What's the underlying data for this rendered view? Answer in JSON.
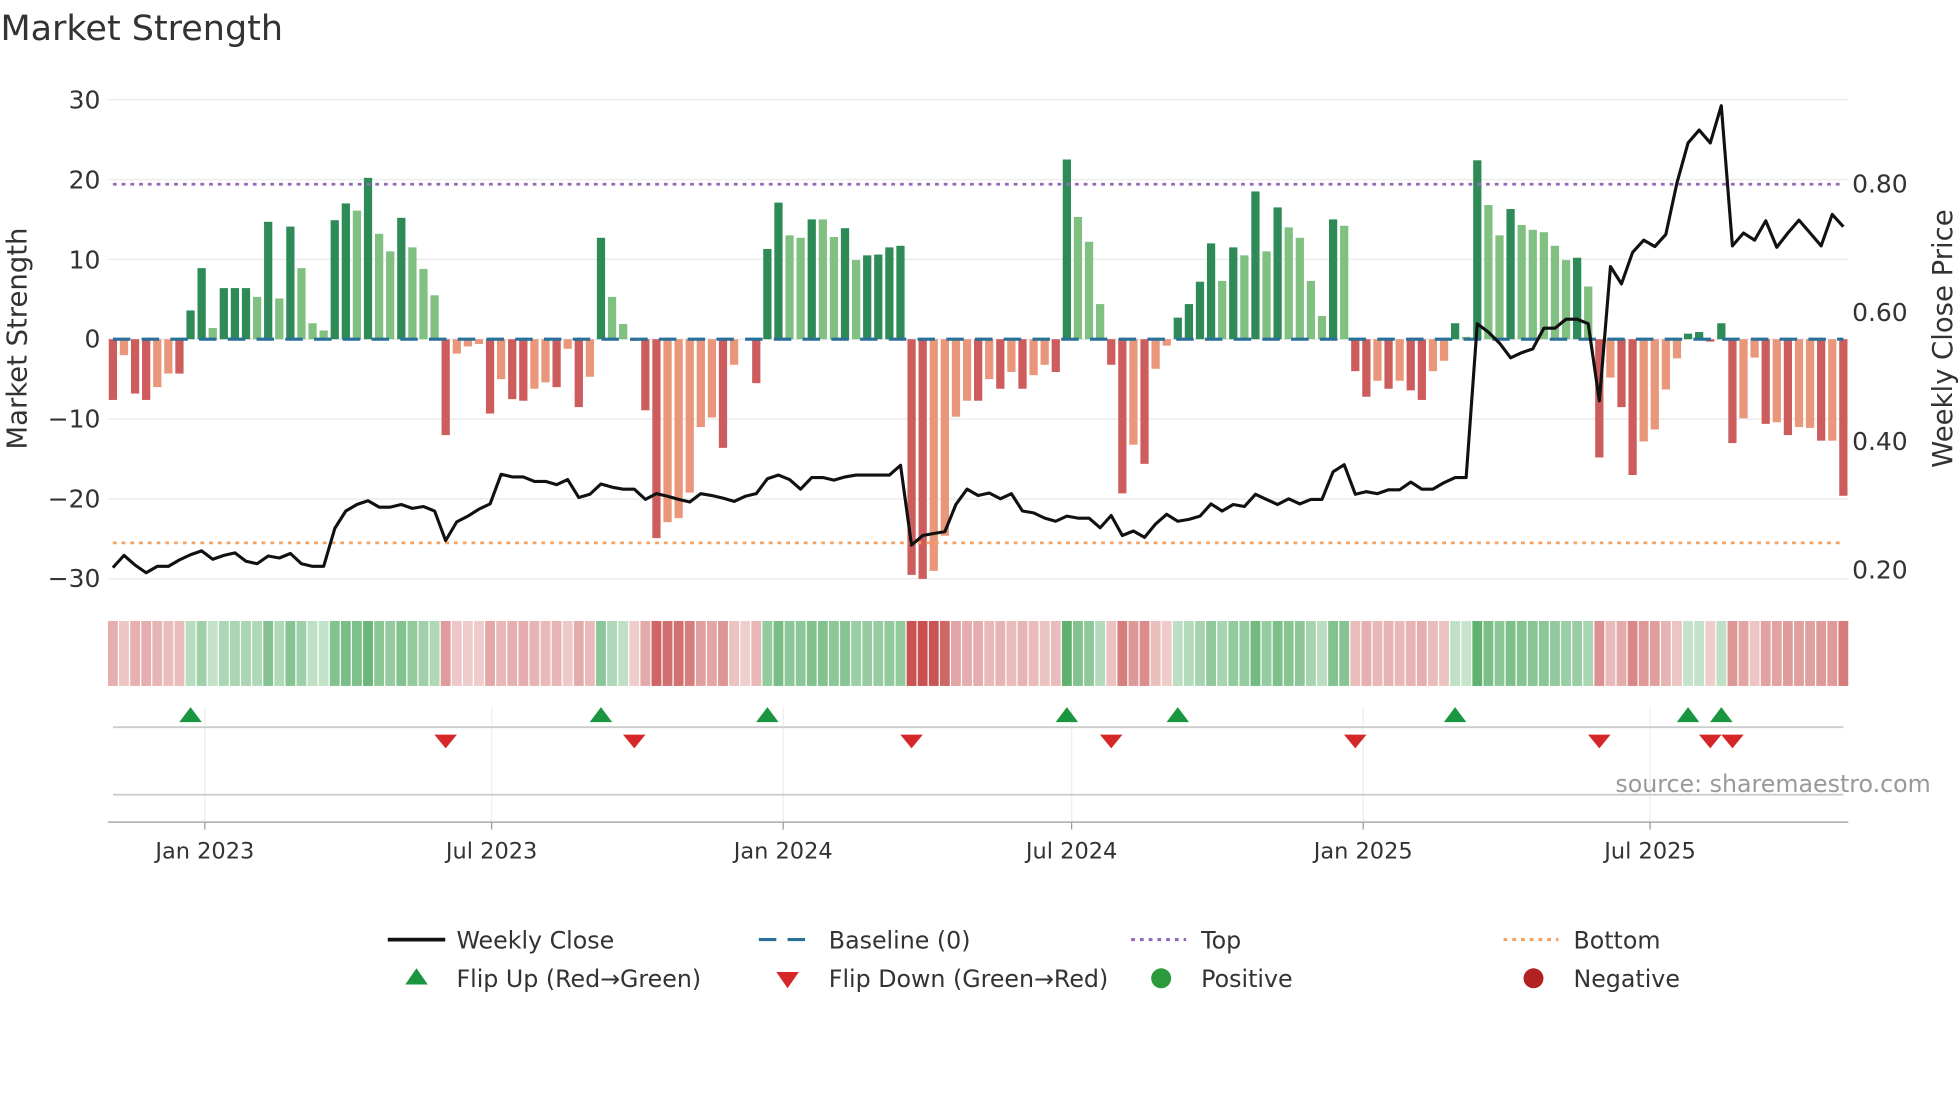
{
  "chart_data": {
    "type": "bar",
    "title": "Market Strength",
    "ylabel": "Market Strength",
    "ylabel_right": "Weekly Close Price",
    "ylim": [
      -32.3,
      32.3
    ],
    "ylim_right": [
      0.157,
      0.959
    ],
    "yticks": [
      "30",
      "20",
      "10",
      "0",
      "−10",
      "−20",
      "−30"
    ],
    "yticks_right": [
      "0.80",
      "0.60",
      "0.40",
      "0.20"
    ],
    "xticks": [
      "Jan 2023",
      "Jul 2023",
      "Jan 2024",
      "Jul 2024",
      "Jan 2025",
      "Jul 2025"
    ],
    "grid": true,
    "legend_placement": "bottom",
    "source": "source: sharemaestro.com",
    "top_level": 19.4,
    "bottom_level": -25.5,
    "dates": [
      "2022-11-04",
      "2022-11-11",
      "2022-11-18",
      "2022-11-25",
      "2022-12-02",
      "2022-12-09",
      "2022-12-16",
      "2022-12-23",
      "2022-12-30",
      "2023-01-06",
      "2023-01-13",
      "2023-01-20",
      "2023-01-27",
      "2023-02-03",
      "2023-02-10",
      "2023-02-17",
      "2023-02-24",
      "2023-03-03",
      "2023-03-10",
      "2023-03-17",
      "2023-03-24",
      "2023-03-31",
      "2023-04-07",
      "2023-04-14",
      "2023-04-21",
      "2023-04-28",
      "2023-05-05",
      "2023-05-12",
      "2023-05-19",
      "2023-05-26",
      "2023-06-02",
      "2023-06-09",
      "2023-06-16",
      "2023-06-23",
      "2023-06-30",
      "2023-07-07",
      "2023-07-14",
      "2023-07-21",
      "2023-07-28",
      "2023-08-04",
      "2023-08-11",
      "2023-08-18",
      "2023-08-25",
      "2023-09-01",
      "2023-09-08",
      "2023-09-15",
      "2023-09-22",
      "2023-09-29",
      "2023-10-06",
      "2023-10-13",
      "2023-10-20",
      "2023-10-27",
      "2023-11-03",
      "2023-11-10",
      "2023-11-17",
      "2023-11-24",
      "2023-12-01",
      "2023-12-08",
      "2023-12-15",
      "2023-12-22",
      "2023-12-29",
      "2024-01-05",
      "2024-01-12",
      "2024-01-19",
      "2024-01-26",
      "2024-02-02",
      "2024-02-09",
      "2024-02-16",
      "2024-02-23",
      "2024-03-01",
      "2024-03-08",
      "2024-03-15",
      "2024-03-22",
      "2024-03-29",
      "2024-04-05",
      "2024-04-12",
      "2024-04-19",
      "2024-04-26",
      "2024-05-03",
      "2024-05-10",
      "2024-05-17",
      "2024-05-24",
      "2024-05-31",
      "2024-06-07",
      "2024-06-14",
      "2024-06-21",
      "2024-06-28",
      "2024-07-05",
      "2024-07-12",
      "2024-07-19",
      "2024-07-26",
      "2024-08-02",
      "2024-08-09",
      "2024-08-16",
      "2024-08-23",
      "2024-08-30",
      "2024-09-06",
      "2024-09-13",
      "2024-09-20",
      "2024-09-27",
      "2024-10-04",
      "2024-10-11",
      "2024-10-18",
      "2024-10-25",
      "2024-11-01",
      "2024-11-08",
      "2024-11-15",
      "2024-11-22",
      "2024-11-29",
      "2024-12-06",
      "2024-12-13",
      "2024-12-20",
      "2024-12-27",
      "2025-01-03",
      "2025-01-10",
      "2025-01-17",
      "2025-01-24",
      "2025-01-31",
      "2025-02-07",
      "2025-02-14",
      "2025-02-21",
      "2025-02-28",
      "2025-03-07",
      "2025-03-14",
      "2025-03-21",
      "2025-03-28",
      "2025-04-04",
      "2025-04-11",
      "2025-04-18",
      "2025-04-25",
      "2025-05-02",
      "2025-05-09",
      "2025-05-16",
      "2025-05-23",
      "2025-05-30",
      "2025-06-06",
      "2025-06-13",
      "2025-06-20",
      "2025-06-27",
      "2025-07-04",
      "2025-07-11",
      "2025-07-18",
      "2025-07-25",
      "2025-08-01",
      "2025-08-08",
      "2025-08-15",
      "2025-08-22",
      "2025-08-29",
      "2025-09-05",
      "2025-09-12",
      "2025-09-19",
      "2025-09-26",
      "2025-10-03",
      "2025-10-10",
      "2025-10-17",
      "2025-10-24",
      "2025-10-31"
    ],
    "strength": [
      -7.6,
      -2,
      -6.8,
      -7.6,
      -6,
      -4.3,
      -4.3,
      3.6,
      8.9,
      1.4,
      6.4,
      6.4,
      6.4,
      5.3,
      14.7,
      5.1,
      14.1,
      8.9,
      2,
      1.1,
      14.9,
      17,
      16.1,
      20.2,
      13.2,
      11,
      15.2,
      11.5,
      8.8,
      5.5,
      -12,
      -1.8,
      -0.9,
      -0.6,
      -9.3,
      -5,
      -7.5,
      -7.7,
      -6.2,
      -5.4,
      -6,
      -1.2,
      -8.5,
      -4.7,
      12.7,
      5.3,
      1.9,
      -0.2,
      -8.9,
      -24.9,
      -22.9,
      -22.4,
      -19.2,
      -11,
      -9.8,
      -13.6,
      -3.2,
      0,
      -5.5,
      11.3,
      17.1,
      13,
      12.7,
      15,
      15,
      12.8,
      13.9,
      9.9,
      10.5,
      10.6,
      11.5,
      11.7,
      -29.5,
      -30,
      -29,
      -24.6,
      -9.7,
      -7.7,
      -7.7,
      -5,
      -6.2,
      -4.1,
      -6.2,
      -4.5,
      -3.2,
      -4.1,
      22.5,
      15.3,
      12.2,
      4.4,
      -3.2,
      -19.3,
      -13.2,
      -15.6,
      -3.7,
      -0.8,
      2.7,
      4.4,
      7.2,
      12,
      7.3,
      11.5,
      10.5,
      18.5,
      11,
      16.5,
      14,
      12.7,
      7.3,
      2.9,
      15,
      14.2,
      -4,
      -7.2,
      -5.2,
      -6.2,
      -5.2,
      -6.4,
      -7.6,
      -4,
      -2.7,
      2,
      0.3,
      22.4,
      16.8,
      13,
      16.3,
      14.3,
      13.7,
      13.4,
      11.7,
      9.9,
      10.2,
      6.6,
      -14.8,
      -4.8,
      -8.5,
      -17,
      -12.8,
      -11.3,
      -6.3,
      -2.4,
      0.7,
      0.9,
      -0.3,
      2,
      -13,
      -9.9,
      -2.3,
      -10.6,
      -10.4,
      -12,
      -11,
      -11.1,
      -12.7,
      -12.7,
      -19.6
    ],
    "strong_shade": [
      1,
      0,
      1,
      1,
      0,
      0,
      1,
      1,
      1,
      0,
      1,
      1,
      1,
      0,
      1,
      0,
      1,
      0,
      0,
      0,
      1,
      1,
      0,
      1,
      0,
      0,
      1,
      0,
      0,
      0,
      1,
      0,
      0,
      0,
      1,
      0,
      1,
      1,
      0,
      0,
      1,
      0,
      1,
      0,
      1,
      0,
      0,
      1,
      1,
      1,
      0,
      0,
      0,
      0,
      0,
      1,
      0,
      0,
      1,
      1,
      1,
      0,
      0,
      1,
      0,
      0,
      1,
      0,
      1,
      1,
      1,
      1,
      1,
      1,
      0,
      0,
      0,
      0,
      1,
      0,
      1,
      0,
      1,
      0,
      0,
      1,
      1,
      0,
      0,
      0,
      1,
      1,
      0,
      1,
      0,
      0,
      1,
      1,
      1,
      1,
      0,
      1,
      0,
      1,
      0,
      1,
      0,
      0,
      0,
      0,
      1,
      0,
      1,
      1,
      0,
      1,
      0,
      1,
      1,
      0,
      0,
      1,
      0,
      1,
      0,
      0,
      1,
      0,
      0,
      0,
      0,
      0,
      1,
      0,
      1,
      0,
      1,
      1,
      0,
      0,
      0,
      0,
      1,
      1,
      1,
      1,
      1,
      0,
      0,
      1,
      0,
      1,
      0,
      0,
      1,
      0,
      1
    ],
    "weekly_close": [
      0.203,
      0.222,
      0.207,
      0.195,
      0.205,
      0.205,
      0.215,
      0.223,
      0.229,
      0.216,
      0.222,
      0.226,
      0.213,
      0.209,
      0.221,
      0.218,
      0.225,
      0.209,
      0.205,
      0.205,
      0.264,
      0.291,
      0.301,
      0.307,
      0.297,
      0.297,
      0.301,
      0.295,
      0.298,
      0.291,
      0.245,
      0.274,
      0.283,
      0.294,
      0.302,
      0.348,
      0.344,
      0.344,
      0.337,
      0.337,
      0.332,
      0.34,
      0.312,
      0.317,
      0.333,
      0.328,
      0.325,
      0.325,
      0.309,
      0.318,
      0.314,
      0.309,
      0.305,
      0.318,
      0.315,
      0.311,
      0.306,
      0.314,
      0.318,
      0.341,
      0.347,
      0.34,
      0.325,
      0.343,
      0.343,
      0.339,
      0.344,
      0.347,
      0.347,
      0.347,
      0.347,
      0.362,
      0.238,
      0.253,
      0.256,
      0.259,
      0.301,
      0.325,
      0.315,
      0.319,
      0.31,
      0.318,
      0.291,
      0.288,
      0.28,
      0.275,
      0.283,
      0.28,
      0.28,
      0.265,
      0.284,
      0.253,
      0.26,
      0.25,
      0.271,
      0.286,
      0.275,
      0.278,
      0.283,
      0.302,
      0.291,
      0.301,
      0.298,
      0.317,
      0.309,
      0.301,
      0.31,
      0.302,
      0.309,
      0.309,
      0.352,
      0.363,
      0.317,
      0.321,
      0.318,
      0.324,
      0.324,
      0.336,
      0.325,
      0.325,
      0.335,
      0.343,
      0.343,
      0.582,
      0.569,
      0.552,
      0.529,
      0.537,
      0.543,
      0.575,
      0.575,
      0.589,
      0.589,
      0.582,
      0.462,
      0.671,
      0.644,
      0.693,
      0.712,
      0.702,
      0.721,
      0.801,
      0.863,
      0.883,
      0.863,
      0.921,
      0.703,
      0.723,
      0.712,
      0.742,
      0.701,
      0.723,
      0.743,
      0.723,
      0.703,
      0.752,
      0.733
    ],
    "flip_up": [
      "2022-12-23",
      "2023-09-08",
      "2023-12-22",
      "2024-06-28",
      "2024-09-06",
      "2025-02-28",
      "2025-07-25",
      "2025-08-15"
    ],
    "flip_down": [
      "2023-06-02",
      "2023-09-29",
      "2024-03-22",
      "2024-07-26",
      "2024-12-27",
      "2025-05-30",
      "2025-08-08",
      "2025-08-22"
    ],
    "legend": {
      "weekly_close": "Weekly Close",
      "baseline": "Baseline (0)",
      "top": "Top",
      "bottom": "Bottom",
      "flip_up": "Flip Up (Red→Green)",
      "flip_down": "Flip Down (Green→Red)",
      "positive": "Positive",
      "negative": "Negative"
    },
    "colors": {
      "strong_positive": "#2e8b57",
      "weak_positive": "#80c080",
      "strong_negative": "#cd5c5c",
      "weak_negative": "#e9967a",
      "weekly_close": "#111111",
      "baseline": "#2a6f97",
      "top": "#9467bd",
      "bottom": "#f4a261",
      "flip_up": "#1a9641",
      "flip_down": "#d62728",
      "positive": "#2a9a3a",
      "negative": "#b22222"
    }
  }
}
